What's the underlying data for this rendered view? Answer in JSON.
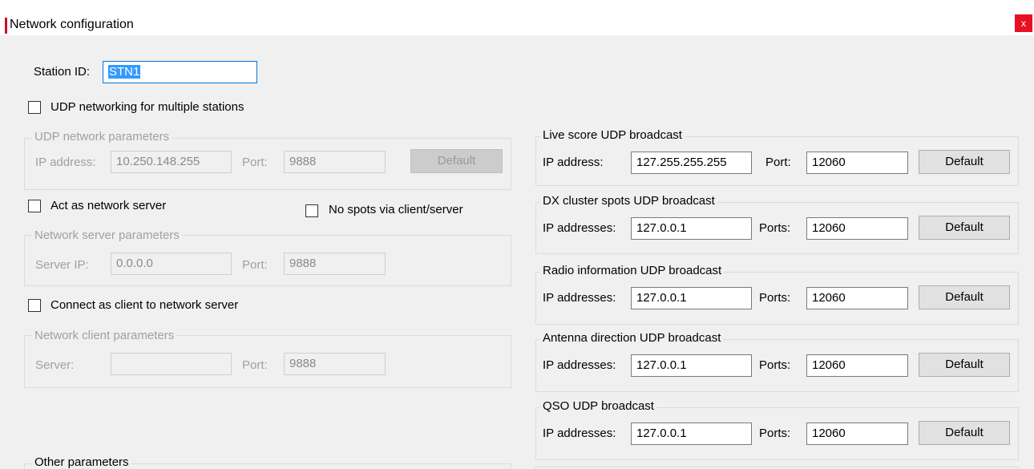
{
  "window": {
    "title": "Network configuration",
    "close_glyph": "x"
  },
  "station": {
    "label": "Station ID:",
    "value": "STN1"
  },
  "udp_networking": {
    "label": "UDP networking for multiple stations",
    "checked": false
  },
  "udp_params": {
    "legend": "UDP network parameters",
    "ip_label": "IP address:",
    "ip_value": "10.250.148.255",
    "port_label": "Port:",
    "port_value": "9888",
    "default_label": "Default"
  },
  "act_server": {
    "label": "Act as network server",
    "checked": false
  },
  "no_spots": {
    "label": "No spots via client/server",
    "checked": false
  },
  "server_params": {
    "legend": "Network server parameters",
    "ip_label": "Server IP:",
    "ip_value": "0.0.0.0",
    "port_label": "Port:",
    "port_value": "9888"
  },
  "connect_client": {
    "label": "Connect as client to network server",
    "checked": false
  },
  "client_params": {
    "legend": "Network client parameters",
    "server_label": "Server:",
    "server_value": "",
    "port_label": "Port:",
    "port_value": "9888"
  },
  "other": {
    "legend": "Other parameters"
  },
  "broadcasts": [
    {
      "title": "Live score UDP broadcast",
      "ip_label": "IP address:",
      "ip_value": "127.255.255.255",
      "port_label": "Port:",
      "port_value": "12060",
      "default_label": "Default"
    },
    {
      "title": "DX cluster spots UDP broadcast",
      "ip_label": "IP addresses:",
      "ip_value": "127.0.0.1",
      "port_label": "Ports:",
      "port_value": "12060",
      "default_label": "Default"
    },
    {
      "title": "Radio information UDP broadcast",
      "ip_label": "IP addresses:",
      "ip_value": "127.0.0.1",
      "port_label": "Ports:",
      "port_value": "12060",
      "default_label": "Default"
    },
    {
      "title": "Antenna direction UDP broadcast",
      "ip_label": "IP addresses:",
      "ip_value": "127.0.0.1",
      "port_label": "Ports:",
      "port_value": "12060",
      "default_label": "Default"
    },
    {
      "title": "QSO UDP broadcast",
      "ip_label": "IP addresses:",
      "ip_value": "127.0.0.1",
      "port_label": "Ports:",
      "port_value": "12060",
      "default_label": "Default"
    }
  ],
  "colors": {
    "selection": "#3399ff",
    "close_button": "#e81123",
    "title_accent": "#c8102e"
  }
}
